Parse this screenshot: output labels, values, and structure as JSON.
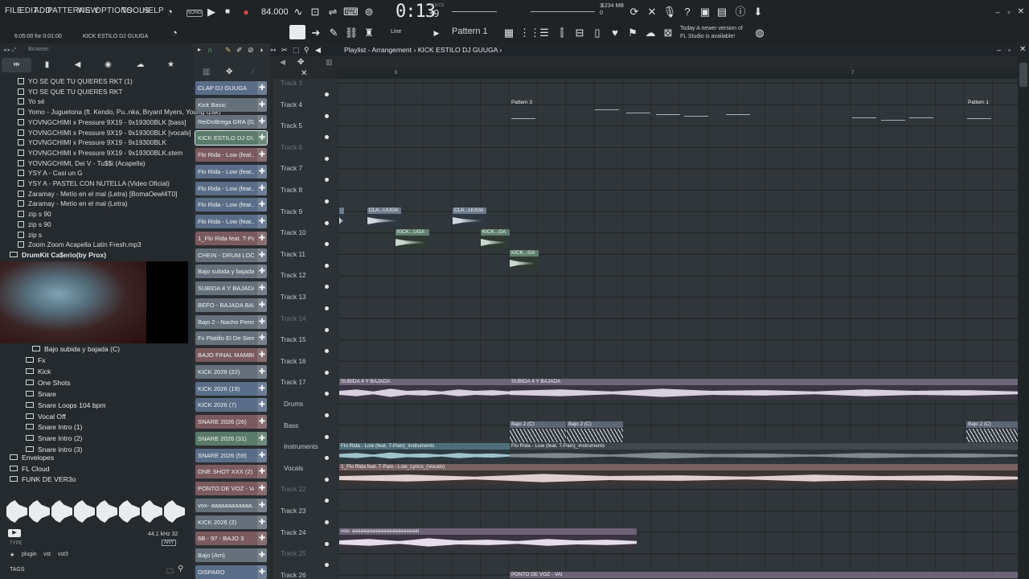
{
  "menu": [
    "FILE",
    "EDIT",
    "ADD",
    "PATTERNS",
    "VIEW",
    "OPTIONS",
    "TOOLS",
    "HELP"
  ],
  "transport": {
    "mode_badge": "SONG",
    "tempo": "84.000",
    "time_main": "0:13",
    "time_sub": "39",
    "time_unit": "M:S:CS",
    "memory": "1234 MB",
    "cpu_top": "3",
    "cpu_bottom": "0"
  },
  "toolbar2": {
    "hint_time": "6:05:00 for 0:01:00",
    "hint_name": "KICK ESTILO DJ GUUGA",
    "snap": "Line",
    "pattern": "Pattern 1",
    "news_line1": "Today  A newer version of",
    "news_line2": "FL Studio is available!"
  },
  "browser": {
    "header": "Browser",
    "tabs": [
      "all-icon",
      "files-icon",
      "plugins-icon",
      "projects-icon",
      "cloud-icon",
      "favorites-icon"
    ],
    "files": [
      "YO SE QUE TU QUIERES RKT (1)",
      "YO SE QUE TU QUIERES RKT",
      "Yo sé",
      "Yomo - Juguetona (ft. Kendo, Pu..nka, Bryant Myers, Young Izak)",
      "YOVNGCHIMI x Pressure 9X19 - 9x19300BLK [bass]",
      "YOVNGCHIMI x Pressure 9X19 - 9x19300BLK [vocals]",
      "YOVNGCHIMI x Pressure 9X19 - 9x19300BLK",
      "YOVNGCHIMI x Pressure 9X19 - 9x19300BLK.stem",
      "YOVNGCHIMI, Dei V - Tu$$i (Acapella)",
      "YSY A - Casi un G",
      "YSY A - PASTEL CON NUTELLA (Video Oficial)",
      "Zaramay - Metío en el mal (Letra) [BomaOewl4T0]",
      "Zaramay - Metío en el mal (Letra)",
      "zip s 90",
      "zip s 90",
      "zip s",
      "Zoom Zoom Acapella Latin Fresh.mp3"
    ],
    "drumkit_folder": "DrumKit Ca$erio(by Prox)",
    "subfolder_open": "Bajo subida y bajada (C)",
    "subfolders": [
      "Fx",
      "Kick",
      "One Shots",
      "Snare",
      "Snare Loops 104 bpm",
      "Vocal Off",
      "Snare Intro (1)",
      "Snare Intro (2)",
      "Snare Intro (3)"
    ],
    "root_folders": [
      "Envelopes",
      "FL Cloud",
      "FUNK DE VER3o"
    ],
    "sample_rate": "44.1 kHz 32",
    "type_label": "TYPE",
    "type_value": "ANY",
    "tags": [
      "plugin",
      "vst",
      "vst3"
    ],
    "tags_label": "TAGS"
  },
  "channels": [
    {
      "name": "CLAP DJ GUUGA",
      "color": "blue"
    },
    {
      "name": "Kick Basic",
      "color": "gray"
    },
    {
      "name": "ReiDoBrega GRA (02)",
      "color": "gray"
    },
    {
      "name": "KICK ESTILO DJ GUUGA",
      "color": "green",
      "selected": true
    },
    {
      "name": "Flo Rida - Low (feat....",
      "color": "red"
    },
    {
      "name": "Flo Rida - Low (feat....",
      "color": "blue"
    },
    {
      "name": "Flo Rida - Low (feat....",
      "color": "blue"
    },
    {
      "name": "Flo Rida - Low (feat....",
      "color": "blue"
    },
    {
      "name": "Flo Rida - Low (feat....",
      "color": "blue"
    },
    {
      "name": "1_Flo Rida feat. T-Pa...",
      "color": "red"
    },
    {
      "name": "CHEIN - DRUM LOOP...",
      "color": "gray"
    },
    {
      "name": "Bajo subida y bajada...",
      "color": "gray"
    },
    {
      "name": "SUBIDA 4 Y BAJADA",
      "color": "gray"
    },
    {
      "name": "BEFO - BAJADA BASS",
      "color": "gray"
    },
    {
      "name": "Bajo 2 - Nacho Pereira",
      "color": "gray"
    },
    {
      "name": "Fx Platillo El De Siem...",
      "color": "gray"
    },
    {
      "name": "BAJO FINAL MAMBO DJ...",
      "color": "red"
    },
    {
      "name": "KICK 2026 (22)",
      "color": "gray"
    },
    {
      "name": "KICK 2026 (19)",
      "color": "blue"
    },
    {
      "name": "KICK 2026 (7)",
      "color": "blue"
    },
    {
      "name": "SNARE 2026 (26)",
      "color": "red"
    },
    {
      "name": "SNARE 2026 (31)",
      "color": "green"
    },
    {
      "name": "SNARE 2026 (59)",
      "color": "blue"
    },
    {
      "name": "ONE SHOT XXX (2)",
      "color": "red"
    },
    {
      "name": "PONTO DE VOZ - VAI",
      "color": "red"
    },
    {
      "name": "vox- aaaaaaaaaaaa...",
      "color": "gray"
    },
    {
      "name": "KICK 2026 (2)",
      "color": "gray"
    },
    {
      "name": "6B - 97 - BAJO 3",
      "color": "red"
    },
    {
      "name": "Bajo (Am)",
      "color": "gray"
    },
    {
      "name": "DISPARO",
      "color": "blue"
    }
  ],
  "playlist": {
    "breadcrumb": "Playlist - Arrangement",
    "pattern_name": "KICK ESTILO DJ GUUGA",
    "timeline_marks": [
      "5",
      "7"
    ],
    "tracks": [
      "Track 3",
      "Track 4",
      "Track 5",
      "Track 6",
      "Track 7",
      "Track 8",
      "Track 9",
      "Track 10",
      "Track 11",
      "Track 12",
      "Track 13",
      "Track 14",
      "Track 15",
      "Track 16",
      "Track 17",
      "Drums",
      "Bass",
      "Instruments",
      "Vocals",
      "Track 22",
      "Track 23",
      "Track 24",
      "Track 25",
      "Track 26"
    ],
    "clips": {
      "pattern3": "Pattern 3",
      "pattern1": "Pattern 1",
      "clap": "CLA...UUGA",
      "kick": "KICK...UGA",
      "kick_ga": "KICK...GA",
      "subida": "SUBIDA 4 Y BAJADA",
      "bajo2": "Bajo 2 (C)",
      "instr": "Flo Rida - Low (feat. T-Pain)_instruments",
      "vocals": "1_Flo Rida feat. T-Pain - Low_Lyrics_(Vocals)",
      "vox": "vox- aaaaaaaaaaaaaaaaaaaaaaai",
      "ponto": "PONTO DE VOZ - VAI"
    }
  }
}
